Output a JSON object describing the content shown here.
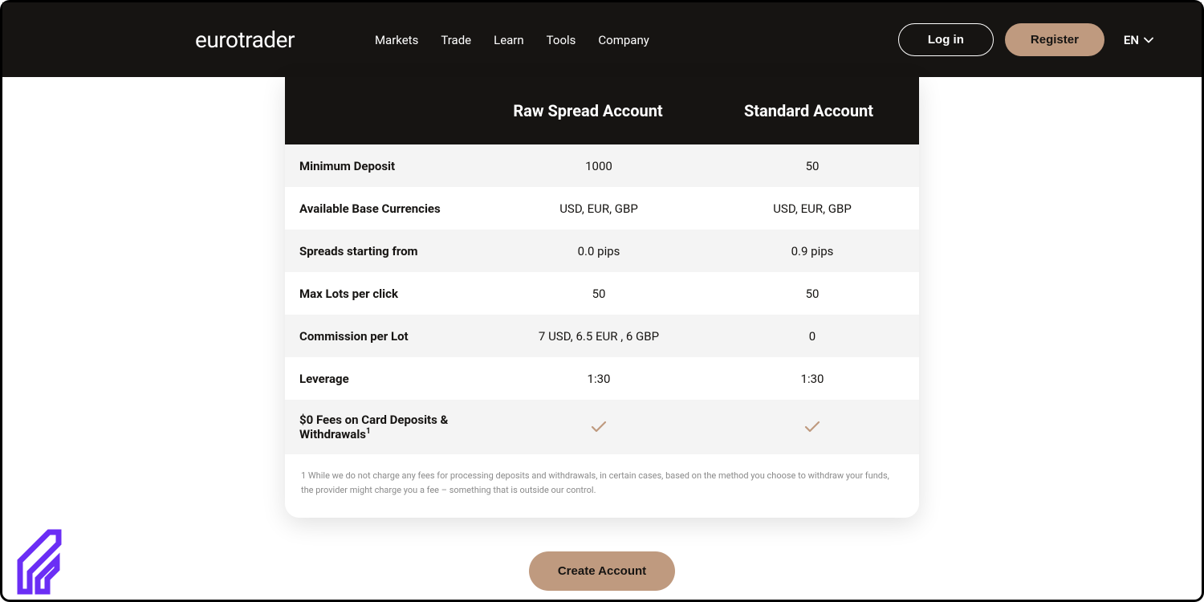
{
  "header": {
    "logo": "eurotrader",
    "nav": [
      "Markets",
      "Trade",
      "Learn",
      "Tools",
      "Company"
    ],
    "login_label": "Log in",
    "register_label": "Register",
    "lang": "EN"
  },
  "table": {
    "col2_header": "Raw Spread Account",
    "col3_header": "Standard Account",
    "rows": [
      {
        "label": "Minimum Deposit",
        "v1": "1000",
        "v2": "50"
      },
      {
        "label": "Available Base Currencies",
        "v1": "USD, EUR, GBP",
        "v2": "USD, EUR, GBP"
      },
      {
        "label": "Spreads starting from",
        "v1": "0.0 pips",
        "v2": "0.9 pips"
      },
      {
        "label": "Max Lots per click",
        "v1": "50",
        "v2": "50"
      },
      {
        "label": "Commission per Lot",
        "v1": "7 USD,  6.5 EUR , 6 GBP",
        "v2": "0"
      },
      {
        "label": "Leverage",
        "v1": "1:30",
        "v2": "1:30"
      }
    ],
    "fees_row_label": "$0 Fees on Card Deposits & Withdrawals",
    "fees_row_sup": "1",
    "footnote": "1  While we do not charge any fees for processing deposits and withdrawals, in certain cases, based on the method you choose to withdraw your funds, the provider might charge you a fee – something that is outside our control."
  },
  "cta": {
    "create_label": "Create Account"
  }
}
